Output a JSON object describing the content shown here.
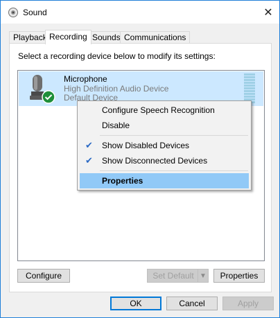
{
  "window": {
    "title": "Sound",
    "close_icon": "close-icon"
  },
  "tabs": [
    {
      "label": "Playback",
      "active": false
    },
    {
      "label": "Recording",
      "active": true
    },
    {
      "label": "Sounds",
      "active": false
    },
    {
      "label": "Communications",
      "active": false
    }
  ],
  "panel": {
    "instruction": "Select a recording device below to modify its settings:"
  },
  "device": {
    "name": "Microphone",
    "description": "High Definition Audio Device",
    "status": "Default Device",
    "icon": "microphone-icon",
    "status_icon": "check-icon"
  },
  "context_menu": {
    "configure_speech": "Configure Speech Recognition",
    "disable": "Disable",
    "show_disabled": "Show Disabled Devices",
    "show_disconnected": "Show Disconnected Devices",
    "properties": "Properties",
    "checkmark": "✔"
  },
  "buttons": {
    "configure": "Configure",
    "set_default": "Set Default",
    "properties": "Properties",
    "ok": "OK",
    "cancel": "Cancel",
    "apply": "Apply"
  },
  "colors": {
    "selection": "#cce8ff",
    "menu_highlight": "#91c9f7",
    "window_border": "#1f7fd8"
  }
}
